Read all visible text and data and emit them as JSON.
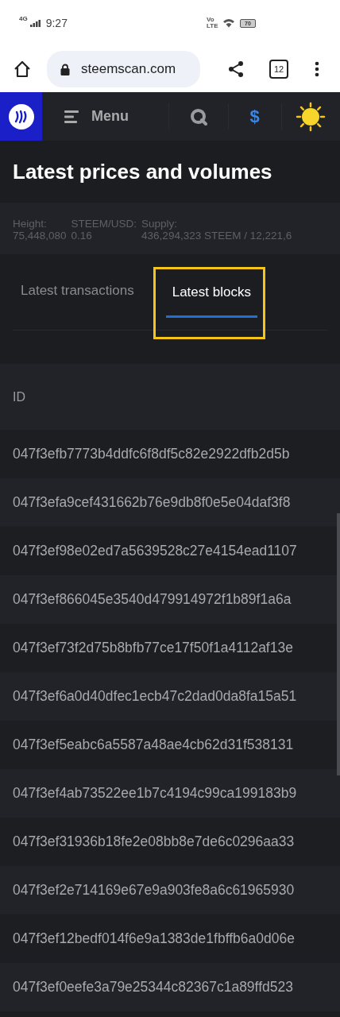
{
  "status_bar": {
    "network": "4G",
    "time": "9:27",
    "volte": "Vo LTE",
    "battery": "70"
  },
  "browser": {
    "url": "steemscan.com",
    "tab_count": "12"
  },
  "nav": {
    "menu_label": "Menu",
    "currency_symbol": "$"
  },
  "title": "Latest prices and volumes",
  "stats": [
    {
      "label": "Height:",
      "value": "75,448,080"
    },
    {
      "label": "STEEM/USD:",
      "value": "0.16"
    },
    {
      "label": "Supply:",
      "value": "436,294,323 STEEM / 12,221,6"
    }
  ],
  "tabs": [
    {
      "label": "Latest transactions",
      "selected": false,
      "highlighted": false
    },
    {
      "label": "Latest blocks",
      "selected": true,
      "highlighted": true
    }
  ],
  "table": {
    "columns": [
      "ID"
    ],
    "rows": [
      "047f3efb7773b4ddfc6f8df5c82e2922dfb2d5b",
      "047f3efa9cef431662b76e9db8f0e5e04daf3f8",
      "047f3ef98e02ed7a5639528c27e4154ead1107",
      "047f3ef866045e3540d479914972f1b89f1a6a",
      "047f3ef73f2d75b8bfb77ce17f50f1a4112af13e",
      "047f3ef6a0d40dfec1ecb47c2dad0da8fa15a51",
      "047f3ef5eabc6a5587a48ae4cb62d31f538131",
      "047f3ef4ab73522ee1b7c4194c99ca199183b9",
      "047f3ef31936b18fe2e08bb8e7de6c0296aa33",
      "047f3ef2e714169e67e9a903fe8a6c61965930",
      "047f3ef12bedf014f6e9a1383de1fbffb6a0d06e",
      "047f3ef0eefe3a79e25344c82367c1a89ffd523"
    ]
  }
}
